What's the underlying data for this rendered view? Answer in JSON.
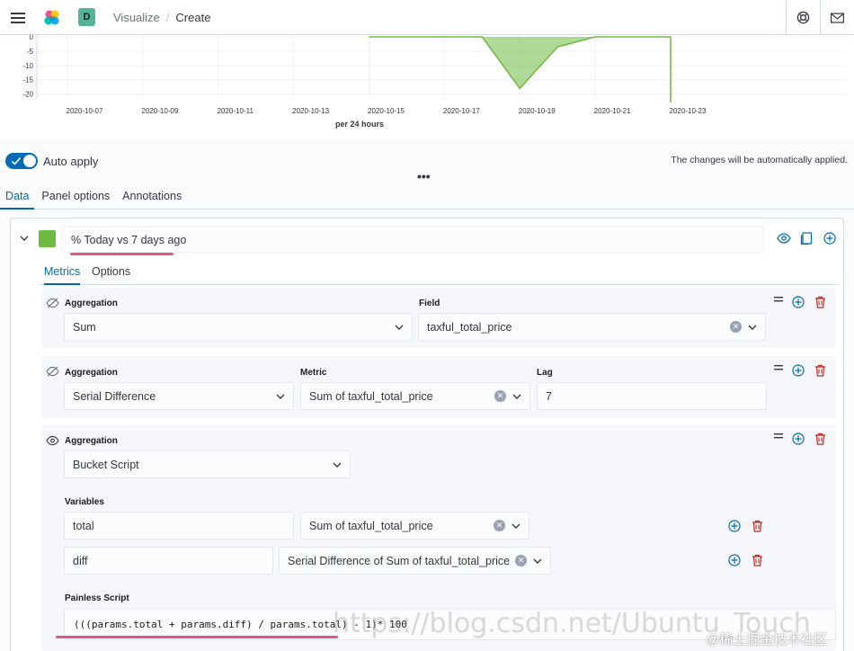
{
  "header": {
    "space_initial": "D",
    "breadcrumbs": [
      "Visualize",
      "Create"
    ],
    "breadcrumb_sep": "/"
  },
  "chart_data": {
    "type": "area",
    "xlabel": "per 24 hours",
    "ylabel": "",
    "x_ticks": [
      "2020-10-07",
      "2020-10-09",
      "2020-10-11",
      "2020-10-13",
      "2020-10-15",
      "2020-10-17",
      "2020-10-19",
      "2020-10-21",
      "2020-10-23"
    ],
    "y_ticks": [
      "0",
      "-5",
      "-10",
      "-15",
      "-20"
    ],
    "ylim": [
      -22,
      0
    ],
    "color": "#6eb93f",
    "x": [
      "2020-10-15",
      "2020-10-16",
      "2020-10-17",
      "2020-10-18",
      "2020-10-19",
      "2020-10-20",
      "2020-10-21",
      "2020-10-22",
      "2020-10-23",
      "2020-10-23"
    ],
    "values": [
      0,
      0,
      0,
      0,
      -18,
      -3.5,
      0,
      0,
      0,
      -23
    ],
    "grid": true
  },
  "apply": {
    "toggle_on": true,
    "label": "Auto apply",
    "message": "The changes will be automatically applied."
  },
  "menu_dots": "•••",
  "tabs": [
    "Data",
    "Panel options",
    "Annotations"
  ],
  "series": {
    "label": "% Today vs 7 days ago",
    "swatch_color": "#6eb93f"
  },
  "subtabs": [
    "Metrics",
    "Options"
  ],
  "metric1": {
    "agg_label": "Aggregation",
    "agg_value": "Sum",
    "field_label": "Field",
    "field_value": "taxful_total_price"
  },
  "metric2": {
    "agg_label": "Aggregation",
    "agg_value": "Serial Difference",
    "metric_label": "Metric",
    "metric_value": "Sum of taxful_total_price",
    "lag_label": "Lag",
    "lag_value": "7"
  },
  "metric3": {
    "agg_label": "Aggregation",
    "agg_value": "Bucket Script",
    "variables_label": "Variables",
    "var1_name": "total",
    "var1_metric": "Sum of taxful_total_price",
    "var2_name": "diff",
    "var2_metric": "Serial Difference of Sum of taxful_total_price",
    "script_label": "Painless Script",
    "script_value": "(((params.total + params.diff) / params.total) - 1)* 100"
  },
  "watermark": "@稀土掘金技术社区",
  "url_watermark": "https://blog.csdn.net/Ubuntu_Touch"
}
